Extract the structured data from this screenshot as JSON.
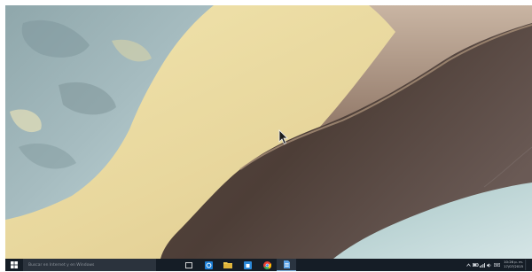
{
  "desktop": {
    "wallpaper": "aerial-sand-dune-wallpaper",
    "cursor": "arrow-pointer"
  },
  "taskbar": {
    "start_icon": "windows-logo-icon",
    "search_placeholder": "Buscar en Internet y en Windows",
    "pinned": [
      {
        "name": "task-view-icon"
      },
      {
        "name": "edge-browser-icon"
      },
      {
        "name": "file-explorer-icon"
      },
      {
        "name": "store-icon"
      },
      {
        "name": "chrome-icon"
      },
      {
        "name": "document-icon",
        "active": true
      }
    ],
    "tray": {
      "icons": [
        "chevron-up-icon",
        "battery-icon",
        "network-icon",
        "volume-icon",
        "keyboard-language-icon"
      ],
      "time": "10:26 p. m.",
      "date": "17/07/2015"
    }
  },
  "colors": {
    "taskbar": "#151d26",
    "search": "#2b333d",
    "sand": "#e9d9a0",
    "shadow_dune": "#4a3a33",
    "water": "#b9d3d6"
  }
}
